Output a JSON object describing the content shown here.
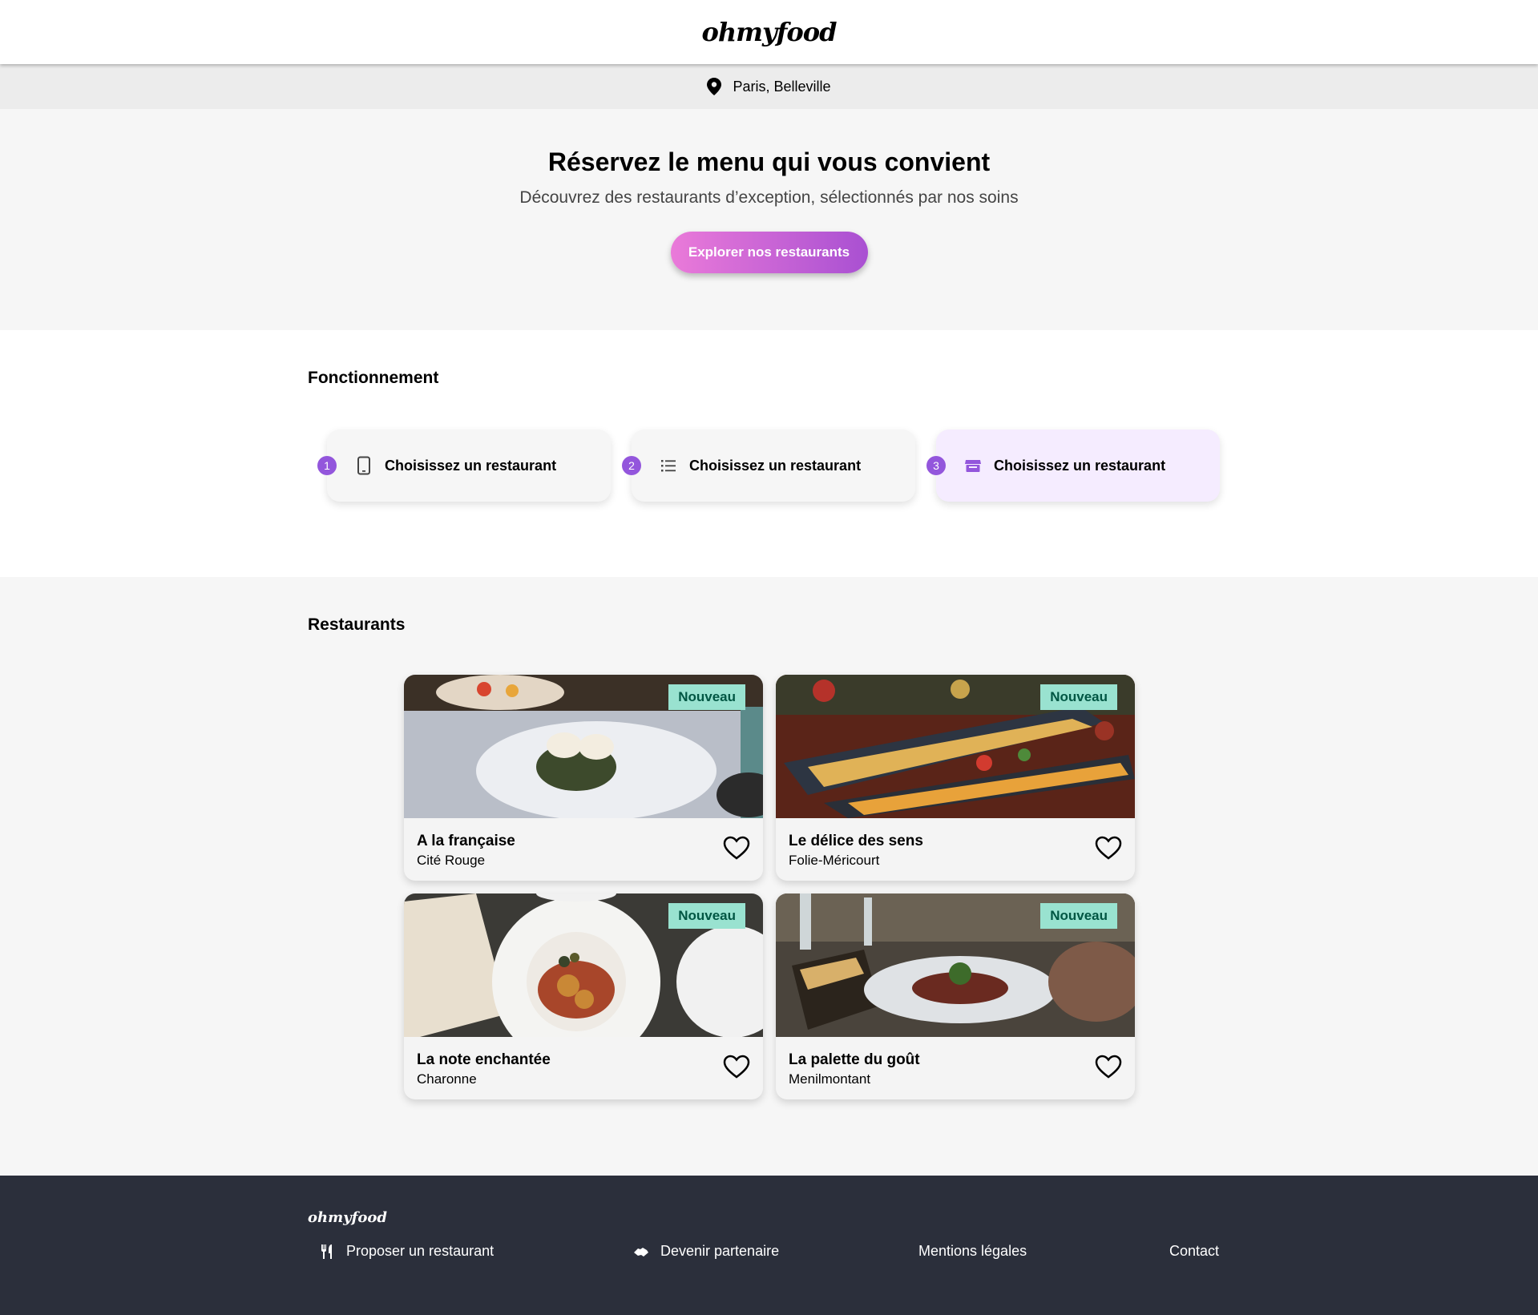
{
  "header": {
    "logo": "ohmyfood"
  },
  "location": {
    "text": "Paris, Belleville",
    "icon": "map-pin-icon"
  },
  "hero": {
    "title": "Réservez le menu qui vous convient",
    "subtitle": "Découvrez des restaurants d’exception, sélectionnés par nos soins",
    "cta_label": "Explorer nos restaurants",
    "cta_gradient": [
      "#ea7ad9",
      "#a950d2"
    ]
  },
  "how": {
    "title": "Fonctionnement",
    "steps": [
      {
        "number": "1",
        "label": "Choisissez un restaurant",
        "icon": "smartphone-icon"
      },
      {
        "number": "2",
        "label": "Choisissez un restaurant",
        "icon": "list-icon"
      },
      {
        "number": "3",
        "label": "Choisissez un restaurant",
        "icon": "store-icon"
      }
    ]
  },
  "restaurants": {
    "title": "Restaurants",
    "items": [
      {
        "name": "A la française",
        "area": "Cité Rouge",
        "badge": "Nouveau"
      },
      {
        "name": "Le délice des sens",
        "area": "Folie-Méricourt",
        "badge": "Nouveau"
      },
      {
        "name": "La note enchantée",
        "area": "Charonne",
        "badge": "Nouveau"
      },
      {
        "name": "La palette du goût",
        "area": "Menilmontant",
        "badge": "Nouveau"
      }
    ]
  },
  "footer": {
    "logo": "ohmyfood",
    "links": [
      {
        "label": "Proposer un restaurant",
        "icon": "utensils-icon"
      },
      {
        "label": "Devenir partenaire",
        "icon": "handshake-icon"
      },
      {
        "label": "Mentions légales"
      },
      {
        "label": "Contact"
      }
    ]
  },
  "colors": {
    "accent": "#9356dc",
    "badge_bg": "#99e2d0",
    "badge_text": "#005643",
    "footer_bg": "#2b2f3b"
  }
}
